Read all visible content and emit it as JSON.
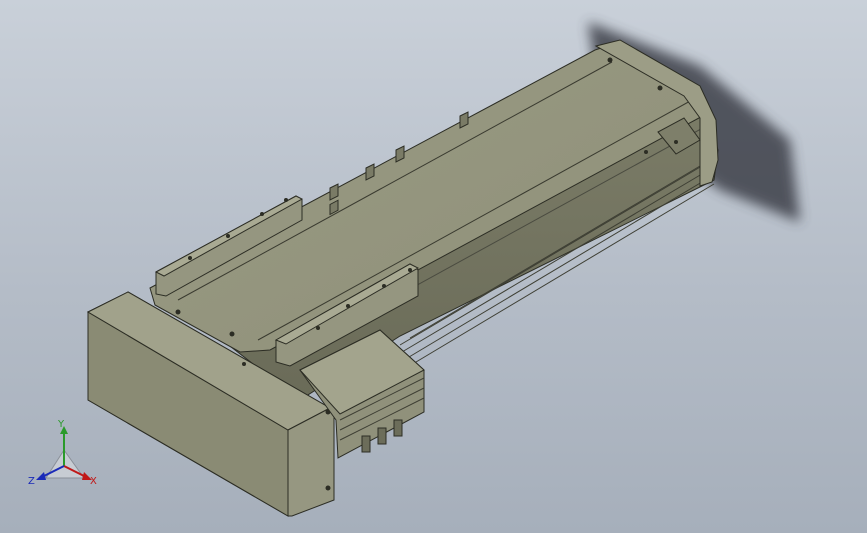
{
  "viewport": {
    "background_top": "#c9d0d9",
    "background_bottom": "#a6afbb",
    "model": {
      "icon": "linear-actuator-model",
      "body_color": "#8a8b74",
      "shadow_color": "#3c4048"
    }
  },
  "triad": {
    "x_label": "X",
    "y_label": "Y",
    "z_label": "Z",
    "x_color": "#c01818",
    "y_color": "#2a9a2a",
    "z_color": "#1a2ab8"
  }
}
